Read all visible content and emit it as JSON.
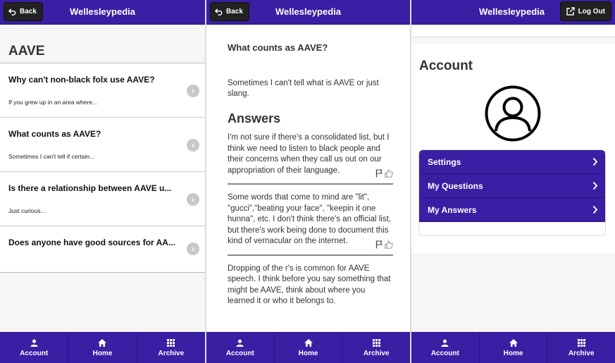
{
  "app": {
    "title": "Wellesleypedia"
  },
  "buttons": {
    "back": "Back",
    "logout": "Log Out"
  },
  "tabs": [
    {
      "label": "Account",
      "icon": "account-icon"
    },
    {
      "label": "Home",
      "icon": "home-icon"
    },
    {
      "label": "Archive",
      "icon": "archive-icon"
    }
  ],
  "topic": {
    "title": "AAVE",
    "questions": [
      {
        "title": "Why can't non-black folx use AAVE?",
        "preview": "If you grew up in an area where..."
      },
      {
        "title": "What counts as AAVE?",
        "preview": "Sometimes I can't tell if certain..."
      },
      {
        "title": "Is there a relationship between AAVE u...",
        "preview": "Just curious..."
      },
      {
        "title": "Does anyone have good sources for AA...",
        "preview": ""
      }
    ]
  },
  "question": {
    "title": "What counts as AAVE?",
    "body": "Sometimes I can't tell what is AAVE or just slang.",
    "answers_heading": "Answers",
    "answers": [
      {
        "text": "I'm not sure if there's a consolidated list, but I think we need to listen to black people and their concerns when they call us out on our appropriation of their language."
      },
      {
        "text": "Some words that come to mind are \"lit\", \"gucci\",\"beating your face\", \"keepin it one hunna\", etc. I don't think there's an official list, but there's work being done to document this kind of vernacular on the internet."
      },
      {
        "text": "Dropping of the r's is common for AAVE speech. I think before you say something that might be AAVE, think about where you learned it or who it belongs to."
      }
    ]
  },
  "account": {
    "title": "Account",
    "menu": [
      {
        "label": "Settings"
      },
      {
        "label": "My Questions"
      },
      {
        "label": "My Answers"
      }
    ]
  },
  "colors": {
    "brand": "#3a1ea3",
    "dark_button": "#222222"
  }
}
